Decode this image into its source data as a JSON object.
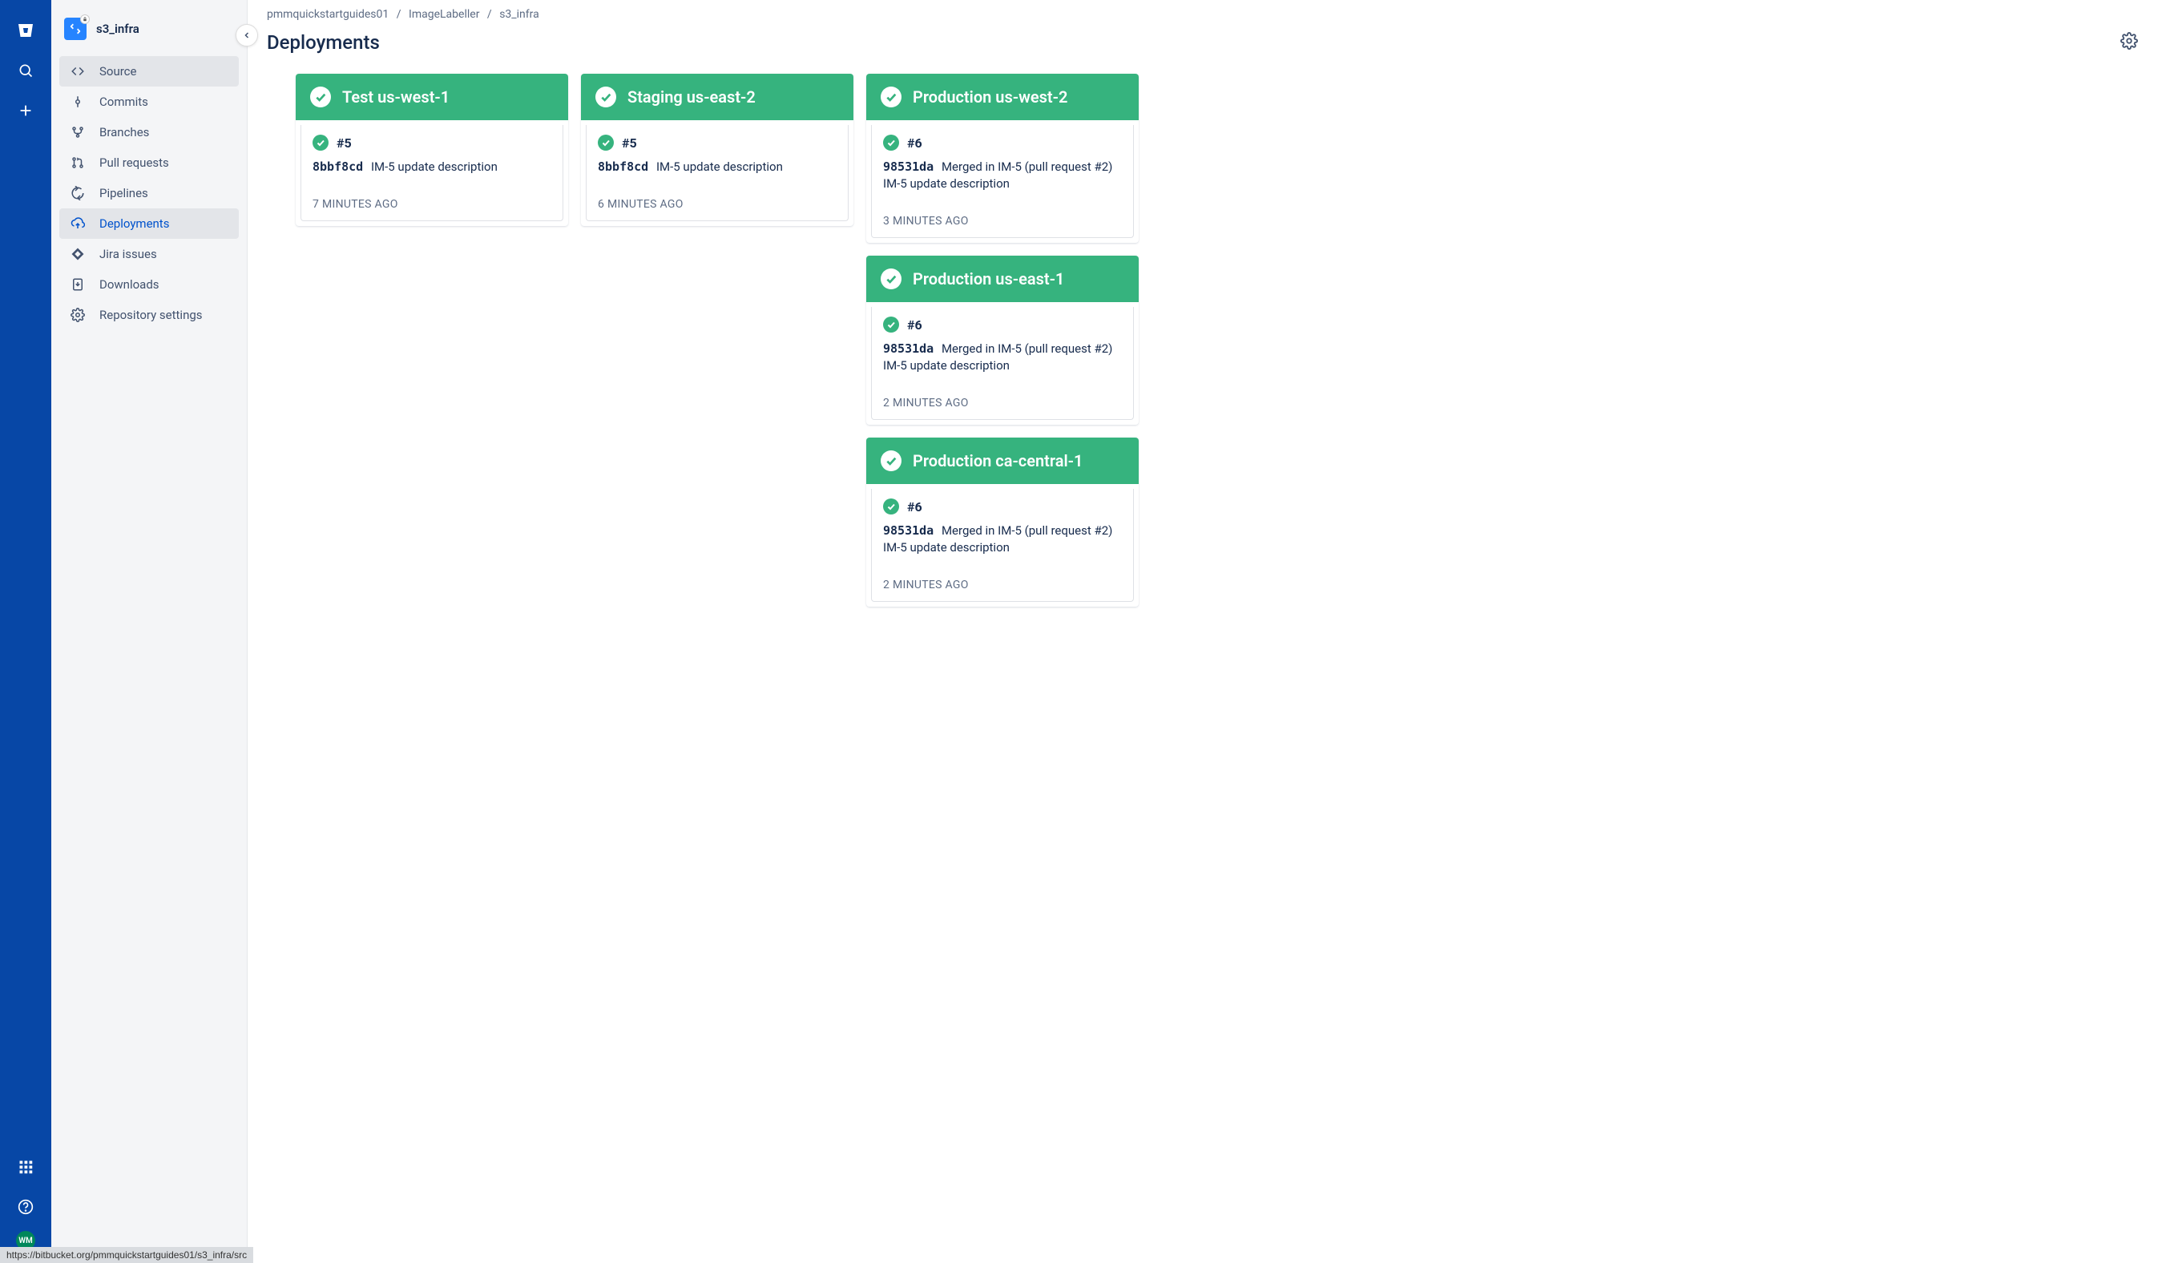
{
  "repo": {
    "name": "s3_infra"
  },
  "breadcrumb": {
    "items": [
      "pmmquickstartguides01",
      "ImageLabeller",
      "s3_infra"
    ]
  },
  "page": {
    "title": "Deployments"
  },
  "sidebar": {
    "items": [
      {
        "label": "Source"
      },
      {
        "label": "Commits"
      },
      {
        "label": "Branches"
      },
      {
        "label": "Pull requests"
      },
      {
        "label": "Pipelines"
      },
      {
        "label": "Deployments"
      },
      {
        "label": "Jira issues"
      },
      {
        "label": "Downloads"
      },
      {
        "label": "Repository settings"
      }
    ]
  },
  "avatar": {
    "initials": "WM"
  },
  "environments": [
    {
      "name": "Test us-west-1",
      "build": "#5",
      "commit_hash": "8bbf8cd",
      "commit_msg": "IM-5 update description",
      "time": "7 MINUTES AGO"
    },
    {
      "name": "Staging us-east-2",
      "build": "#5",
      "commit_hash": "8bbf8cd",
      "commit_msg": "IM-5 update description",
      "time": "6 MINUTES AGO"
    },
    {
      "name": "Production us-west-2",
      "build": "#6",
      "commit_hash": "98531da",
      "commit_msg": "Merged in IM-5 (pull request #2) IM-5 update description",
      "time": "3 MINUTES AGO"
    },
    {
      "name": "Production us-east-1",
      "build": "#6",
      "commit_hash": "98531da",
      "commit_msg": "Merged in IM-5 (pull request #2) IM-5 update description",
      "time": "2 MINUTES AGO"
    },
    {
      "name": "Production ca-central-1",
      "build": "#6",
      "commit_hash": "98531da",
      "commit_msg": "Merged in IM-5 (pull request #2) IM-5 update description",
      "time": "2 MINUTES AGO"
    }
  ],
  "status_url": "https://bitbucket.org/pmmquickstartguides01/s3_infra/src"
}
